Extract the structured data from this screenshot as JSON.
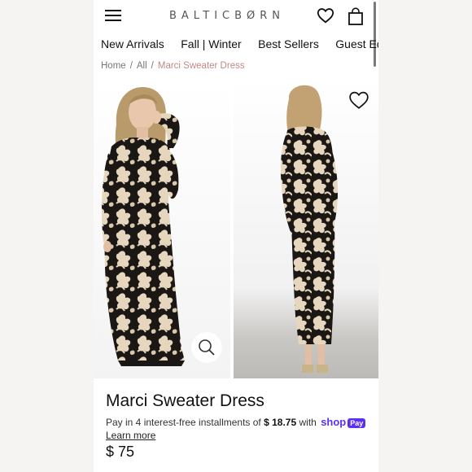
{
  "header": {
    "brand": "BALTICBØRN",
    "menu_icon": "hamburger-menu-icon",
    "wishlist_icon": "heart-outline-icon",
    "cart_icon": "shopping-bag-icon"
  },
  "nav": {
    "items": [
      {
        "label": "New Arrivals"
      },
      {
        "label": "Fall | Winter"
      },
      {
        "label": "Best Sellers"
      },
      {
        "label": "Guest Edit"
      }
    ]
  },
  "breadcrumb": {
    "items": [
      {
        "label": "Home"
      },
      {
        "label": "All"
      },
      {
        "label": "Marci Sweater Dress"
      }
    ],
    "separator": "/"
  },
  "gallery": {
    "zoom_icon": "magnifier-icon",
    "wishlist_icon": "heart-outline-icon"
  },
  "product": {
    "title": "Marci Sweater Dress",
    "installments_prefix": "Pay in 4 interest-free installments of",
    "installment_amount": "$ 18.75",
    "installments_with": "with",
    "shop_logo": "shop",
    "shop_pay_badge": "Pay",
    "learn_more": "Learn more",
    "price": "$ 75"
  },
  "colors": {
    "breadcrumb_current": "#c08a86",
    "shop_pay": "#5a31f4",
    "dress_base": "#1b1714",
    "dress_pattern": "#e6d6bd"
  }
}
